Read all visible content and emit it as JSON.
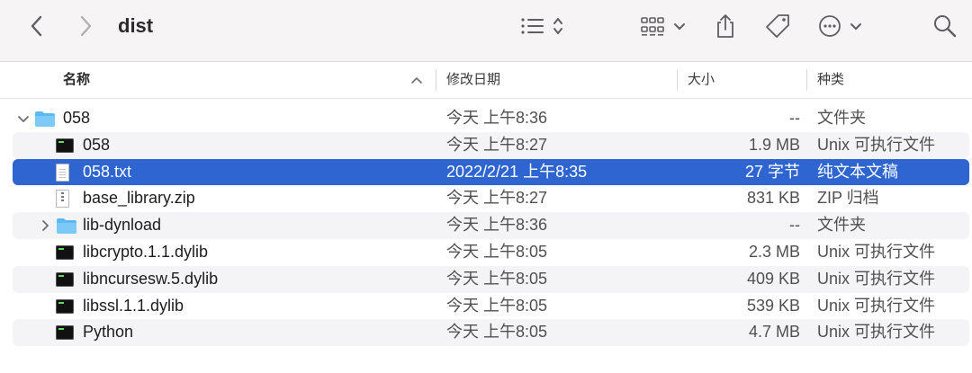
{
  "window": {
    "title": "dist"
  },
  "icons": {
    "back": "chevron-left-icon",
    "forward": "chevron-right-icon",
    "view_list": "list-view-icon",
    "view_grid": "grid-view-icon",
    "share": "share-icon",
    "tag": "tag-icon",
    "more": "ellipsis-circle-icon",
    "search": "magnifying-glass-icon"
  },
  "columns": {
    "name": "名称",
    "date": "修改日期",
    "size": "大小",
    "kind": "种类"
  },
  "rows": [
    {
      "name": "058",
      "date": "今天 上午8:36",
      "size": "--",
      "kind": "文件夹",
      "icon": "folder-icon",
      "disclosure": "expanded"
    },
    {
      "name": "058",
      "date": "今天 上午8:27",
      "size": "1.9 MB",
      "kind": "Unix 可执行文件",
      "icon": "executable-icon"
    },
    {
      "name": "058.txt",
      "date": "2022/2/21 上午8:35",
      "size": "27 字节",
      "kind": "纯文本文稿",
      "icon": "text-file-icon",
      "selected": true
    },
    {
      "name": "base_library.zip",
      "date": "今天 上午8:27",
      "size": "831 KB",
      "kind": "ZIP 归档",
      "icon": "zip-file-icon"
    },
    {
      "name": "lib-dynload",
      "date": "今天 上午8:36",
      "size": "--",
      "kind": "文件夹",
      "icon": "folder-icon",
      "disclosure": "collapsed"
    },
    {
      "name": "libcrypto.1.1.dylib",
      "date": "今天 上午8:05",
      "size": "2.3 MB",
      "kind": "Unix 可执行文件",
      "icon": "executable-icon"
    },
    {
      "name": "libncursesw.5.dylib",
      "date": "今天 上午8:05",
      "size": "409 KB",
      "kind": "Unix 可执行文件",
      "icon": "executable-icon"
    },
    {
      "name": "libssl.1.1.dylib",
      "date": "今天 上午8:05",
      "size": "539 KB",
      "kind": "Unix 可执行文件",
      "icon": "executable-icon"
    },
    {
      "name": "Python",
      "date": "今天 上午8:05",
      "size": "4.7 MB",
      "kind": "Unix 可执行文件",
      "icon": "executable-icon"
    }
  ],
  "colors": {
    "selection": "#2f65d0",
    "folder": "#5cb8f0",
    "toolbar_bg": "#f6f4f4"
  }
}
